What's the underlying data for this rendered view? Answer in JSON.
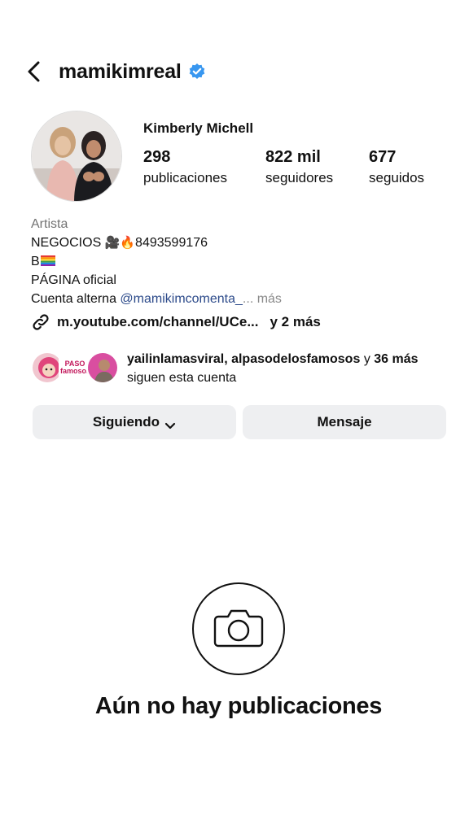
{
  "header": {
    "back_icon": "chevron-left-icon",
    "username": "mamikimreal",
    "verified_icon": "verified-badge-icon",
    "verified_color": "#3897f0"
  },
  "profile": {
    "display_name": "Kimberly Michell",
    "stats": [
      {
        "value": "298",
        "label": "publicaciones"
      },
      {
        "value": "822 mil",
        "label": "seguidores"
      },
      {
        "value": "677",
        "label": "seguidos"
      }
    ]
  },
  "bio": {
    "category": "Artista",
    "line1_text": "NEGOCIOS",
    "line1_emojis": "🎥🔥",
    "line1_phone": "8493599176",
    "line2_text": "B",
    "line2_emoji": "🏳️‍🌈",
    "line3": "PÁGINA oficial",
    "line4_prefix": "Cuenta alterna",
    "line4_mention": "@mamikimcomenta_",
    "line4_more": "... más"
  },
  "link": {
    "icon": "link-icon",
    "url": "m.youtube.com/channel/UCe...",
    "more": "y 2 más"
  },
  "followed_by": {
    "names": "yailinlamasviral, alpasodelosfamosos",
    "middle": "y",
    "count": "36",
    "more_label": "más",
    "suffix": "siguen esta cuenta",
    "mini_logo_text": "PASO famosos"
  },
  "buttons": {
    "following": "Siguiendo",
    "message": "Mensaje"
  },
  "empty_state": {
    "icon": "camera-icon",
    "title": "Aún no hay publicaciones"
  }
}
